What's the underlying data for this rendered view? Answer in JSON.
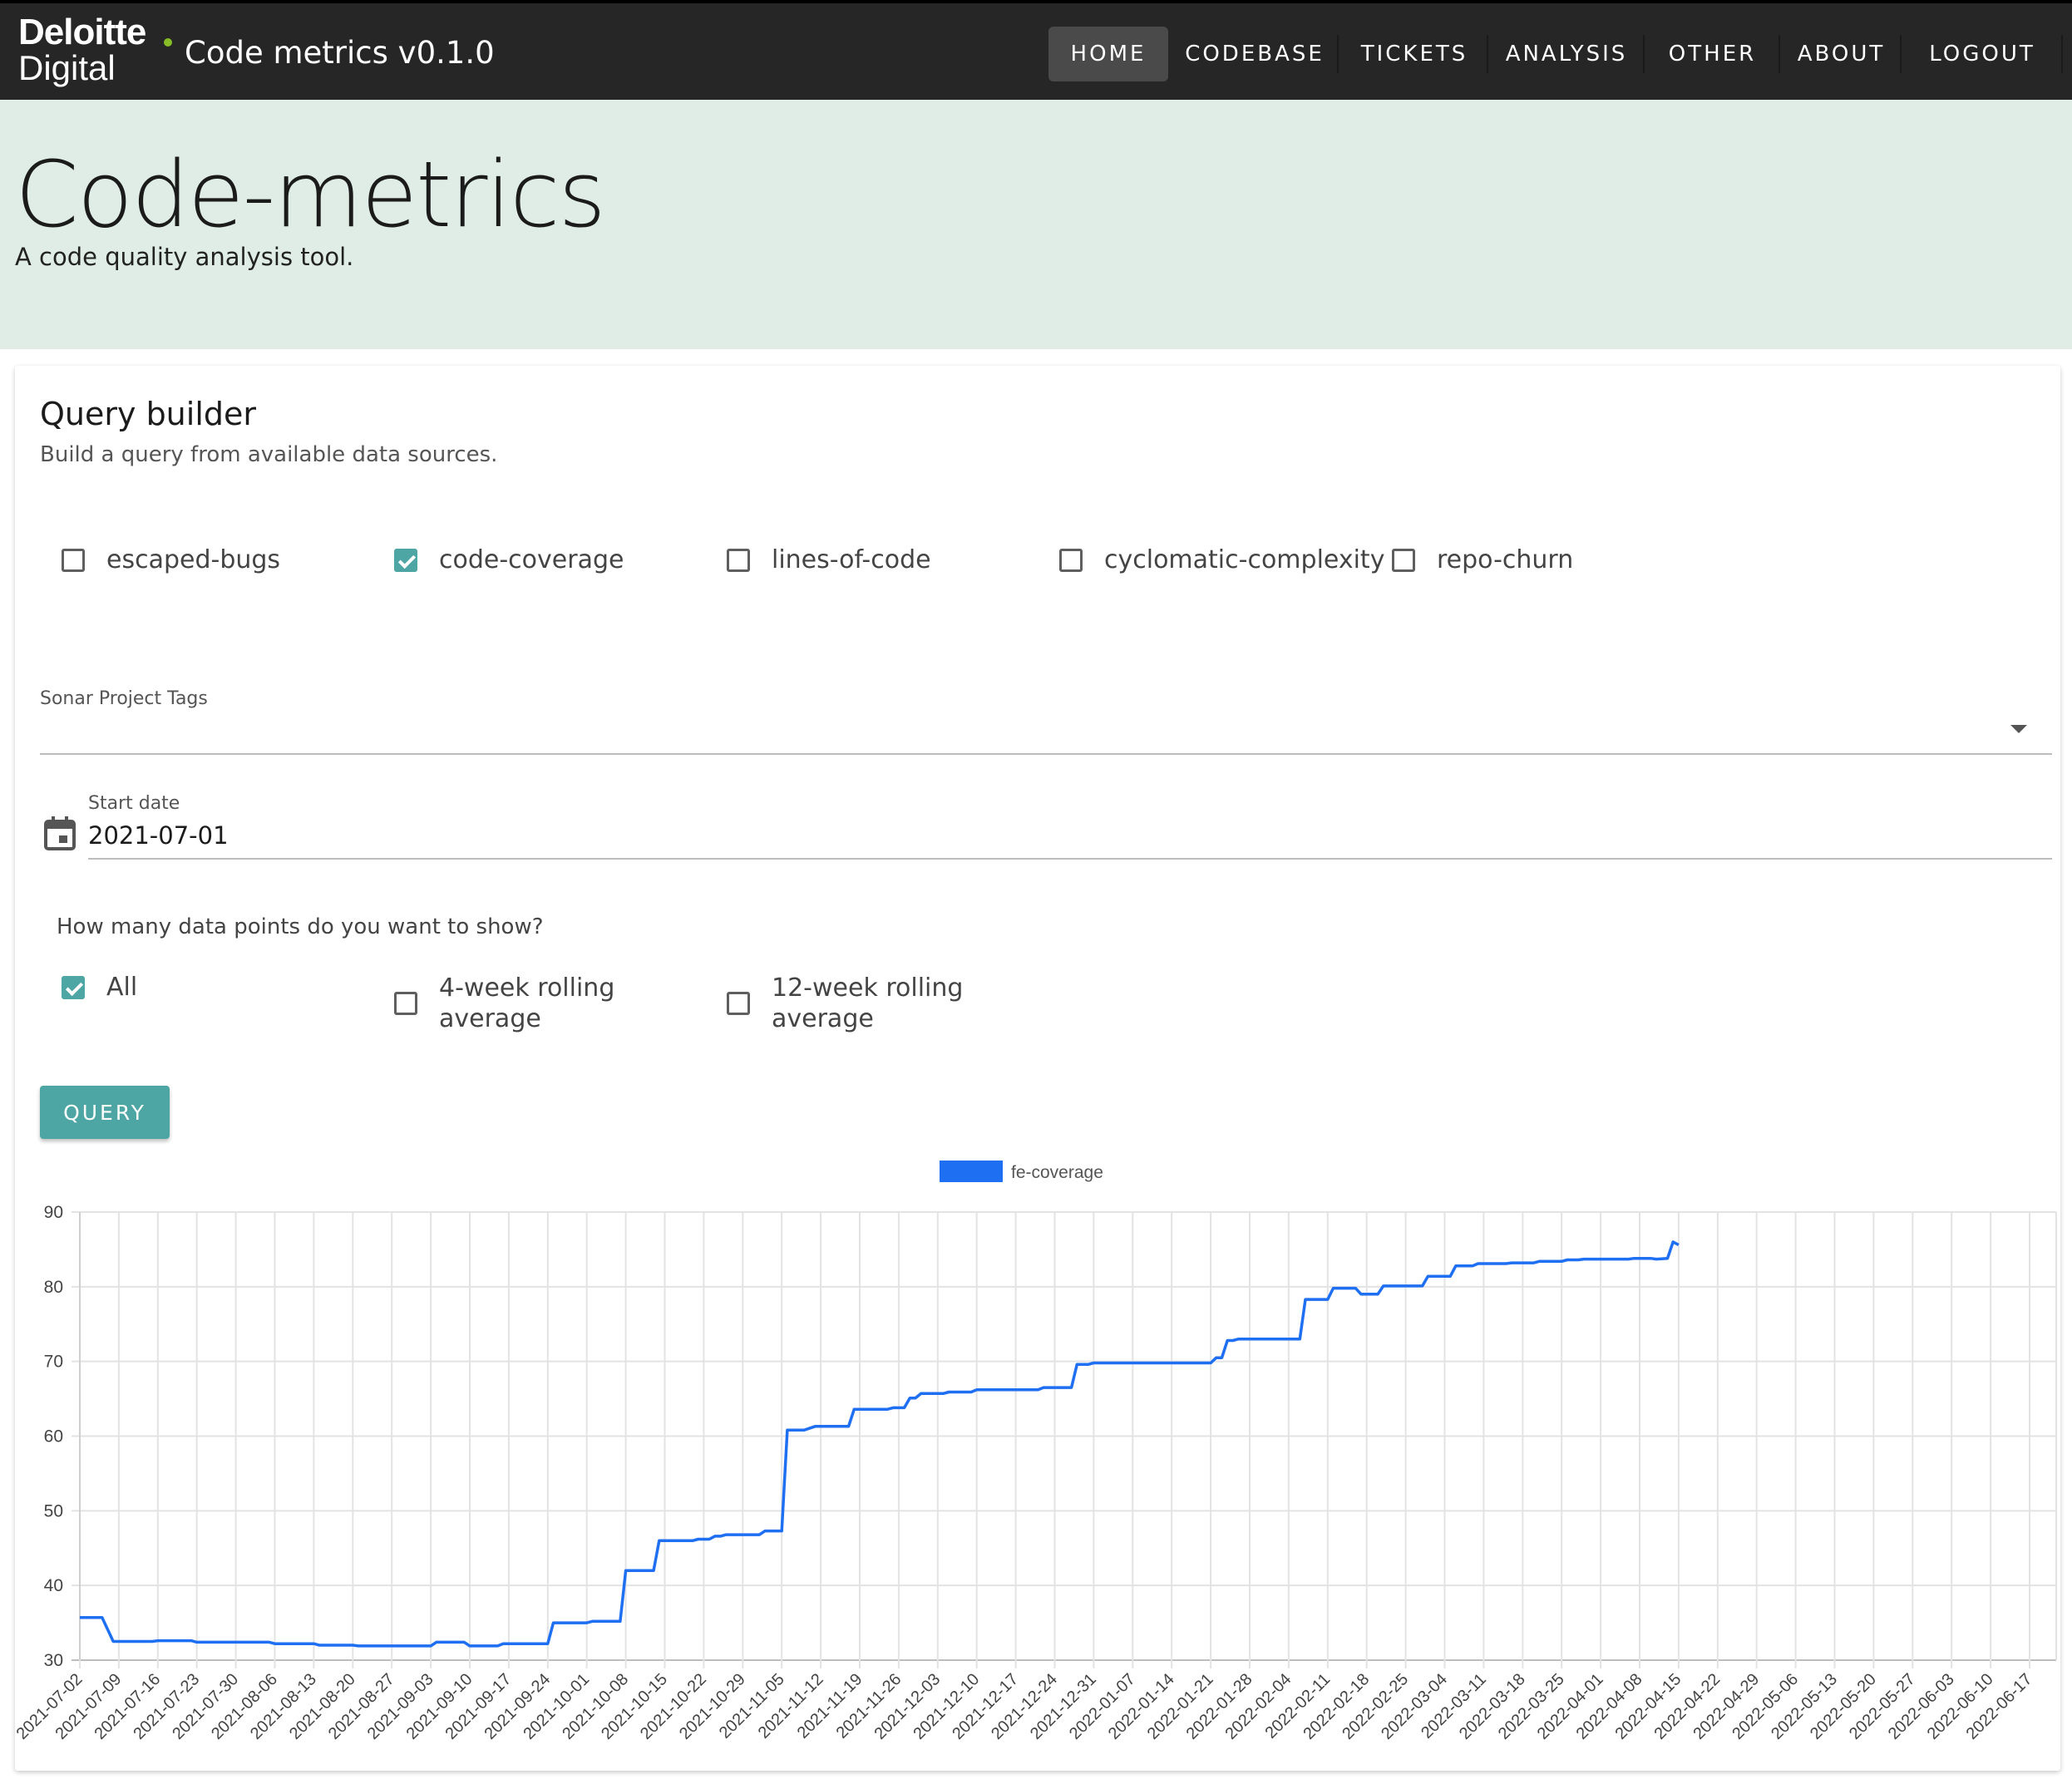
{
  "header": {
    "brand_line1": "Deloitte",
    "brand_line2": "Digital",
    "app_title": "Code metrics v0.1.0",
    "nav": [
      {
        "label": "HOME",
        "active": true
      },
      {
        "label": "CODEBASE",
        "active": false
      },
      {
        "label": "TICKETS",
        "active": false
      },
      {
        "label": "ANALYSIS",
        "active": false
      },
      {
        "label": "OTHER",
        "active": false
      },
      {
        "label": "ABOUT",
        "active": false
      },
      {
        "label": "LOGOUT",
        "active": false
      }
    ]
  },
  "hero": {
    "title": "Code-metrics",
    "subtitle": "A code quality analysis tool."
  },
  "query_builder": {
    "title": "Query builder",
    "subtitle": "Build a query from available data sources.",
    "sources": [
      {
        "label": "escaped-bugs",
        "checked": false
      },
      {
        "label": "code-coverage",
        "checked": true
      },
      {
        "label": "lines-of-code",
        "checked": false
      },
      {
        "label": "cyclomatic-complexity",
        "checked": false
      },
      {
        "label": "repo-churn",
        "checked": false
      }
    ],
    "tags_label": "Sonar Project Tags",
    "tags_value": "",
    "start_date_label": "Start date",
    "start_date": "2021-07-01",
    "points_question": "How many data points do you want to show?",
    "points_options": [
      {
        "label_line1": "All",
        "label_line2": "",
        "checked": true
      },
      {
        "label_line1": "4-week rolling",
        "label_line2": "average",
        "checked": false
      },
      {
        "label_line1": "12-week rolling",
        "label_line2": "average",
        "checked": false
      }
    ],
    "query_button": "QUERY"
  },
  "colors": {
    "series": "#1f6ff2",
    "accent": "#4da6a4",
    "hero_bg": "#dfede6",
    "topbar_bg": "#262626"
  },
  "icons": {
    "start_date": "calendar-icon",
    "tags_dropdown": "dropdown-arrow-icon"
  },
  "chart_data": {
    "type": "line",
    "legend": "fe-coverage",
    "legend_position": "top-center",
    "grid": true,
    "ylim": [
      30,
      90
    ],
    "y_ticks": [
      30,
      40,
      50,
      60,
      70,
      80,
      90
    ],
    "x_ticks": [
      "2021-07-02",
      "2021-07-09",
      "2021-07-16",
      "2021-07-23",
      "2021-07-30",
      "2021-08-06",
      "2021-08-13",
      "2021-08-20",
      "2021-08-27",
      "2021-09-03",
      "2021-09-10",
      "2021-09-17",
      "2021-09-24",
      "2021-10-01",
      "2021-10-08",
      "2021-10-15",
      "2021-10-22",
      "2021-10-29",
      "2021-11-05",
      "2021-11-12",
      "2021-11-19",
      "2021-11-26",
      "2021-12-03",
      "2021-12-10",
      "2021-12-17",
      "2021-12-24",
      "2021-12-31",
      "2022-01-07",
      "2022-01-14",
      "2022-01-21",
      "2022-01-28",
      "2022-02-04",
      "2022-02-11",
      "2022-02-18",
      "2022-02-25",
      "2022-03-04",
      "2022-03-11",
      "2022-03-18",
      "2022-03-25",
      "2022-04-01",
      "2022-04-08",
      "2022-04-15",
      "2022-04-22",
      "2022-04-29",
      "2022-05-06",
      "2022-05-13",
      "2022-05-20",
      "2022-05-27",
      "2022-06-03",
      "2022-06-10",
      "2022-06-17"
    ],
    "series": [
      {
        "name": "fe-coverage",
        "points": [
          [
            "2021-07-02",
            35.7
          ],
          [
            "2021-07-06",
            35.7
          ],
          [
            "2021-07-08",
            32.5
          ],
          [
            "2021-07-15",
            32.5
          ],
          [
            "2021-07-16",
            32.6
          ],
          [
            "2021-07-22",
            32.6
          ],
          [
            "2021-07-23",
            32.4
          ],
          [
            "2021-08-05",
            32.4
          ],
          [
            "2021-08-06",
            32.2
          ],
          [
            "2021-08-13",
            32.2
          ],
          [
            "2021-08-14",
            32.0
          ],
          [
            "2021-08-20",
            32.0
          ],
          [
            "2021-08-21",
            31.9
          ],
          [
            "2021-09-03",
            31.9
          ],
          [
            "2021-09-04",
            32.4
          ],
          [
            "2021-09-09",
            32.4
          ],
          [
            "2021-09-10",
            31.9
          ],
          [
            "2021-09-15",
            31.9
          ],
          [
            "2021-09-16",
            32.2
          ],
          [
            "2021-09-24",
            32.2
          ],
          [
            "2021-09-25",
            35.0
          ],
          [
            "2021-10-01",
            35.0
          ],
          [
            "2021-10-02",
            35.2
          ],
          [
            "2021-10-07",
            35.2
          ],
          [
            "2021-10-08",
            42.0
          ],
          [
            "2021-10-13",
            42.0
          ],
          [
            "2021-10-14",
            46.0
          ],
          [
            "2021-10-20",
            46.0
          ],
          [
            "2021-10-21",
            46.2
          ],
          [
            "2021-10-23",
            46.2
          ],
          [
            "2021-10-24",
            46.6
          ],
          [
            "2021-10-25",
            46.6
          ],
          [
            "2021-10-26",
            46.8
          ],
          [
            "2021-11-01",
            46.8
          ],
          [
            "2021-11-02",
            47.3
          ],
          [
            "2021-11-05",
            47.3
          ],
          [
            "2021-11-06",
            60.8
          ],
          [
            "2021-11-09",
            60.8
          ],
          [
            "2021-11-11",
            61.3
          ],
          [
            "2021-11-17",
            61.3
          ],
          [
            "2021-11-18",
            63.6
          ],
          [
            "2021-11-24",
            63.6
          ],
          [
            "2021-11-25",
            63.8
          ],
          [
            "2021-11-27",
            63.8
          ],
          [
            "2021-11-28",
            65.1
          ],
          [
            "2021-11-29",
            65.1
          ],
          [
            "2021-11-30",
            65.7
          ],
          [
            "2021-12-04",
            65.7
          ],
          [
            "2021-12-05",
            65.9
          ],
          [
            "2021-12-09",
            65.9
          ],
          [
            "2021-12-10",
            66.2
          ],
          [
            "2021-12-21",
            66.2
          ],
          [
            "2021-12-22",
            66.5
          ],
          [
            "2021-12-27",
            66.5
          ],
          [
            "2021-12-28",
            69.6
          ],
          [
            "2021-12-30",
            69.6
          ],
          [
            "2021-12-31",
            69.8
          ],
          [
            "2022-01-21",
            69.8
          ],
          [
            "2022-01-22",
            70.5
          ],
          [
            "2022-01-23",
            70.5
          ],
          [
            "2022-01-24",
            72.8
          ],
          [
            "2022-01-25",
            72.8
          ],
          [
            "2022-01-26",
            73.0
          ],
          [
            "2022-02-06",
            73.0
          ],
          [
            "2022-02-07",
            78.3
          ],
          [
            "2022-02-11",
            78.3
          ],
          [
            "2022-02-12",
            79.8
          ],
          [
            "2022-02-16",
            79.8
          ],
          [
            "2022-02-17",
            79.0
          ],
          [
            "2022-02-20",
            79.0
          ],
          [
            "2022-02-21",
            80.1
          ],
          [
            "2022-02-28",
            80.1
          ],
          [
            "2022-03-01",
            81.4
          ],
          [
            "2022-03-05",
            81.4
          ],
          [
            "2022-03-06",
            82.8
          ],
          [
            "2022-03-09",
            82.8
          ],
          [
            "2022-03-10",
            83.1
          ],
          [
            "2022-03-15",
            83.1
          ],
          [
            "2022-03-16",
            83.2
          ],
          [
            "2022-03-20",
            83.2
          ],
          [
            "2022-03-21",
            83.4
          ],
          [
            "2022-03-25",
            83.4
          ],
          [
            "2022-03-26",
            83.6
          ],
          [
            "2022-03-28",
            83.6
          ],
          [
            "2022-03-29",
            83.7
          ],
          [
            "2022-04-06",
            83.7
          ],
          [
            "2022-04-07",
            83.8
          ],
          [
            "2022-04-10",
            83.8
          ],
          [
            "2022-04-11",
            83.7
          ],
          [
            "2022-04-13",
            83.8
          ],
          [
            "2022-04-14",
            86.0
          ],
          [
            "2022-04-15",
            85.6
          ]
        ]
      }
    ]
  }
}
